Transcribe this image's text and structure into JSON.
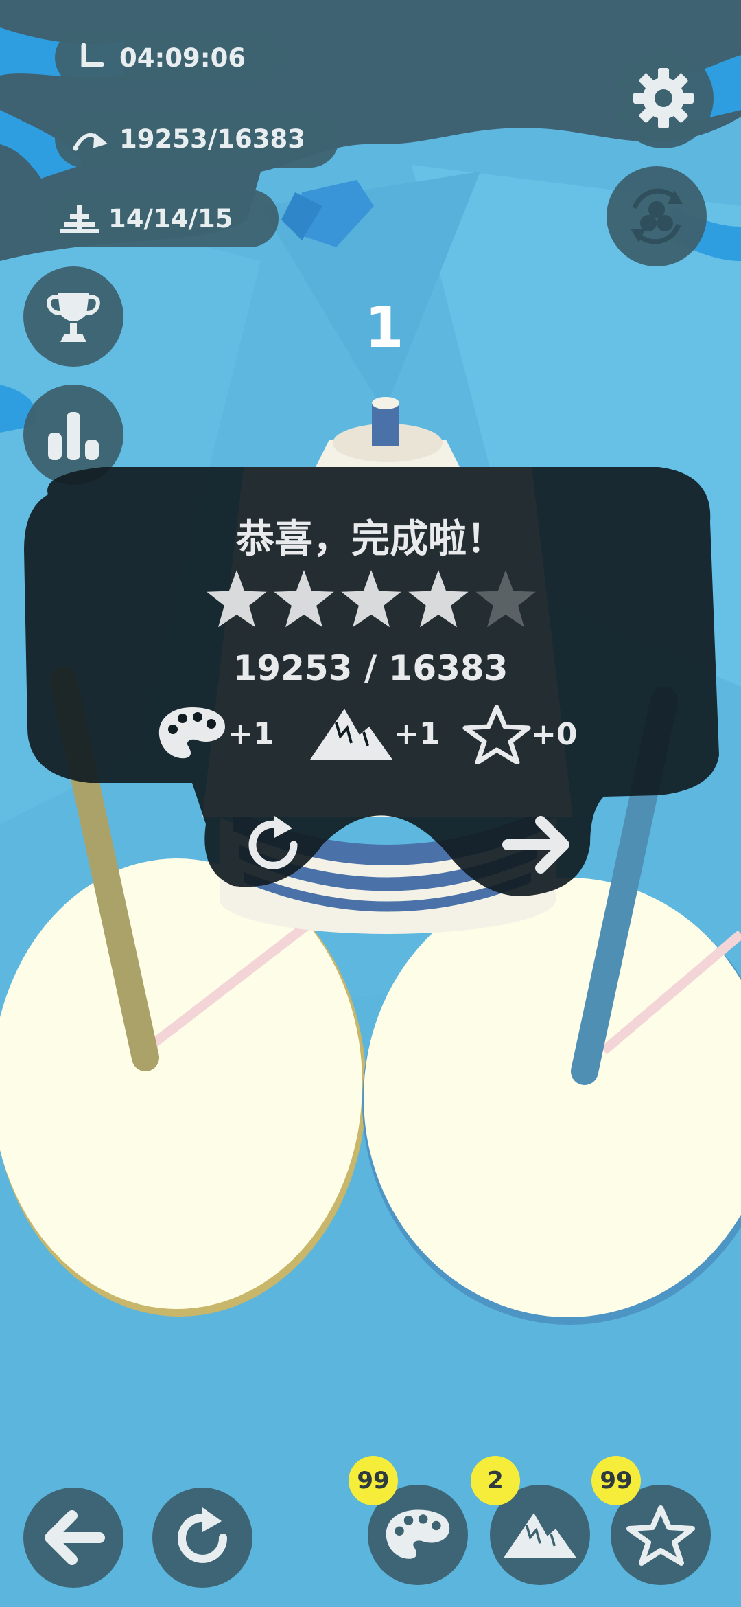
{
  "stats": {
    "time": "04:09:06",
    "moves": "19253/16383",
    "level": "14/14/15"
  },
  "move_counter": "1",
  "result": {
    "title": "恭喜，完成啦！",
    "stars_earned": 4,
    "stars_total": 5,
    "score": "19253 / 16383",
    "rewards": [
      {
        "icon": "palette-icon",
        "text": "+1"
      },
      {
        "icon": "mountain-icon",
        "text": "+1"
      },
      {
        "icon": "star-icon",
        "text": "+0"
      }
    ]
  },
  "powerups": [
    {
      "icon": "palette-icon",
      "count": "99"
    },
    {
      "icon": "mountain-icon",
      "count": "2"
    },
    {
      "icon": "star-icon",
      "count": "99"
    }
  ],
  "colors": {
    "sky": "#5db7df",
    "panel": "#3d6270",
    "overlay": "#111c22",
    "badge": "#f6ec3a",
    "disk_light": "#f4f1e6",
    "disk_blue": "#4a72a8"
  }
}
